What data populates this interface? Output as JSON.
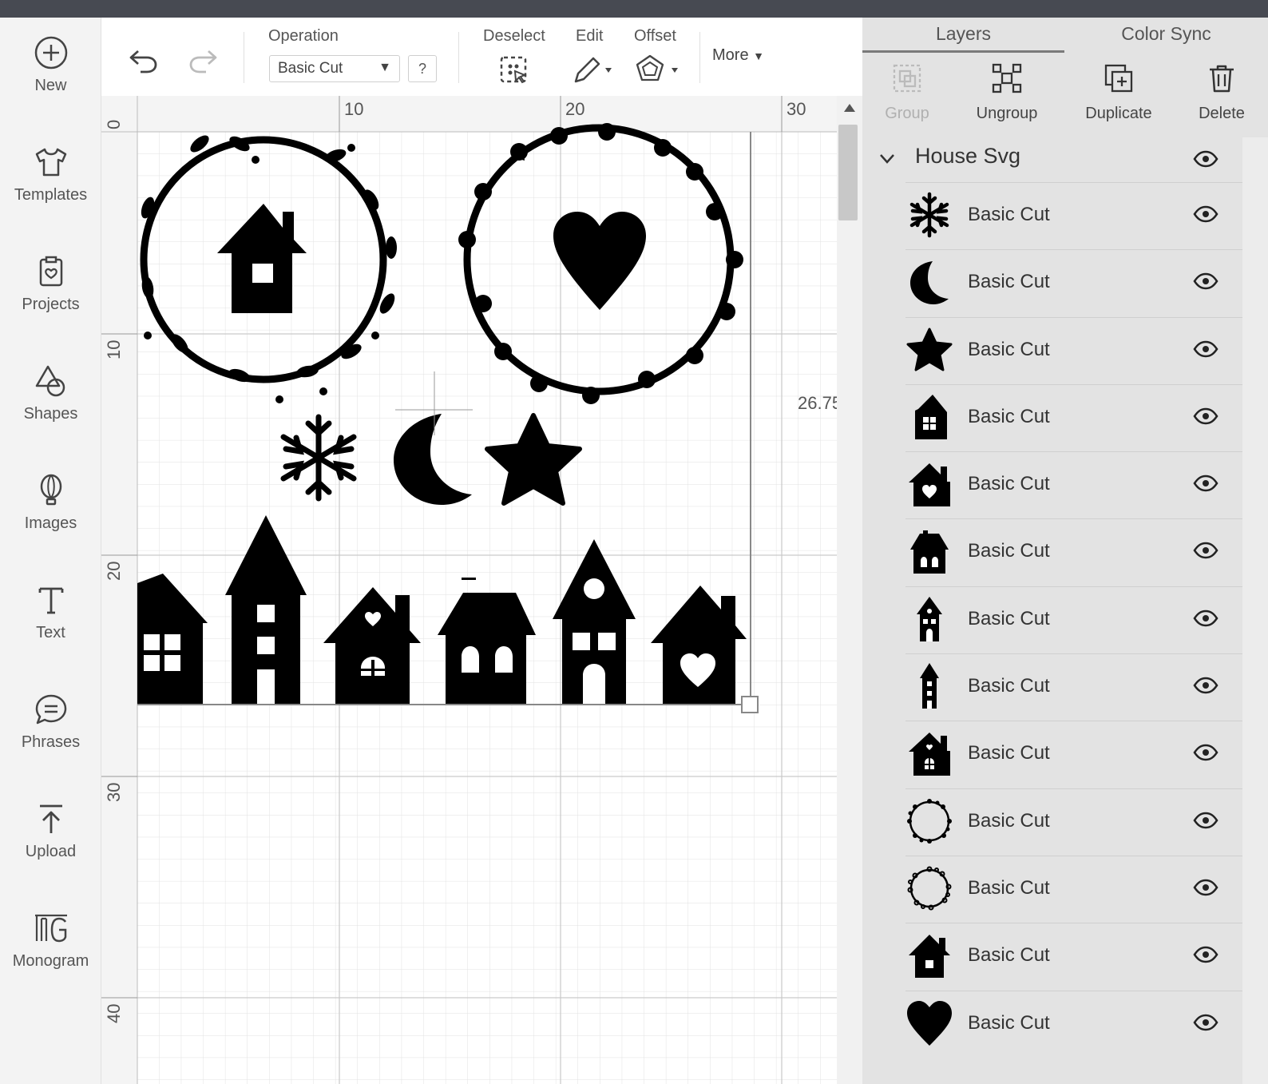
{
  "sidebar": {
    "items": [
      {
        "label": "New",
        "icon": "plus-circle-icon"
      },
      {
        "label": "Templates",
        "icon": "tshirt-icon"
      },
      {
        "label": "Projects",
        "icon": "clipboard-icon"
      },
      {
        "label": "Shapes",
        "icon": "shapes-icon"
      },
      {
        "label": "Images",
        "icon": "lightbulb-icon"
      },
      {
        "label": "Text",
        "icon": "text-icon"
      },
      {
        "label": "Phrases",
        "icon": "speech-bubble-icon"
      },
      {
        "label": "Upload",
        "icon": "upload-icon"
      },
      {
        "label": "Monogram",
        "icon": "monogram-icon"
      }
    ]
  },
  "toolbar": {
    "operation_label": "Operation",
    "operation_value": "Basic Cut",
    "help_label": "?",
    "deselect_label": "Deselect",
    "edit_label": "Edit",
    "offset_label": "Offset",
    "more_label": "More"
  },
  "canvas": {
    "ruler_top": [
      "10",
      "20",
      "30"
    ],
    "ruler_left": [
      "0",
      "10",
      "20",
      "30",
      "40"
    ],
    "dimension_label": "26.75"
  },
  "panel": {
    "tabs": {
      "layers": "Layers",
      "color_sync": "Color Sync"
    },
    "actions": {
      "group": "Group",
      "ungroup": "Ungroup",
      "duplicate": "Duplicate",
      "delete": "Delete"
    },
    "group_title": "House Svg",
    "layers": [
      {
        "label": "Basic Cut",
        "icon": "snowflake-icon"
      },
      {
        "label": "Basic Cut",
        "icon": "moon-icon"
      },
      {
        "label": "Basic Cut",
        "icon": "star-icon"
      },
      {
        "label": "Basic Cut",
        "icon": "house-window-icon"
      },
      {
        "label": "Basic Cut",
        "icon": "house-heart-icon"
      },
      {
        "label": "Basic Cut",
        "icon": "house-doors-icon"
      },
      {
        "label": "Basic Cut",
        "icon": "tower-house-icon"
      },
      {
        "label": "Basic Cut",
        "icon": "tall-house-icon"
      },
      {
        "label": "Basic Cut",
        "icon": "house-heart-window-icon"
      },
      {
        "label": "Basic Cut",
        "icon": "heart-wreath-icon"
      },
      {
        "label": "Basic Cut",
        "icon": "leaf-wreath-icon"
      },
      {
        "label": "Basic Cut",
        "icon": "small-house-icon"
      },
      {
        "label": "Basic Cut",
        "icon": "heart-icon"
      }
    ]
  }
}
